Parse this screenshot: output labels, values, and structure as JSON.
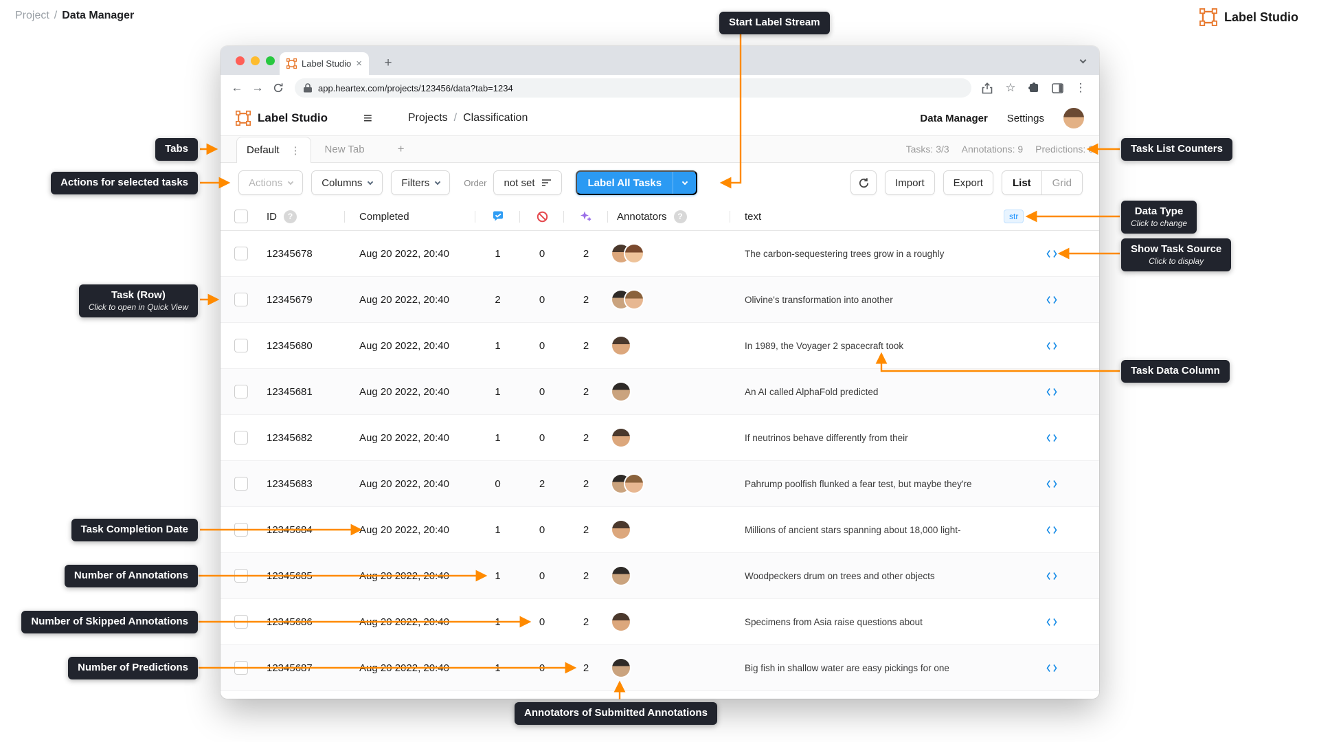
{
  "page": {
    "breadcrumb": {
      "section": "Project",
      "separator": "/",
      "current": "Data Manager"
    },
    "brand": "Label Studio"
  },
  "browser": {
    "tab_title": "Label Studio",
    "url": "app.heartex.com/projects/123456/data?tab=1234"
  },
  "header": {
    "brand": "Label Studio",
    "nav_projects": "Projects",
    "nav_separator": "/",
    "nav_current": "Classification",
    "menu_data_manager": "Data Manager",
    "menu_settings": "Settings"
  },
  "tabs": {
    "default_tab": "Default",
    "new_tab": "New Tab",
    "counters": {
      "tasks": "Tasks: 3/3",
      "annotations": "Annotations: 9",
      "predictions": "Predictions: 0"
    }
  },
  "toolbar": {
    "actions": "Actions",
    "columns": "Columns",
    "filters": "Filters",
    "order_label": "Order",
    "order_value": "not set",
    "label_all_tasks": "Label All Tasks",
    "import": "Import",
    "export": "Export",
    "list": "List",
    "grid": "Grid"
  },
  "table": {
    "headers": {
      "id": "ID",
      "completed": "Completed",
      "annotators": "Annotators",
      "text": "text",
      "data_type_badge": "str"
    },
    "rows": [
      {
        "id": "12345678",
        "completed": "Aug 20 2022, 20:40",
        "annotated": 1,
        "skipped": 0,
        "predictions": 2,
        "annotators": 2,
        "text": "The carbon-sequestering trees grow in a roughly"
      },
      {
        "id": "12345679",
        "completed": "Aug 20 2022, 20:40",
        "annotated": 2,
        "skipped": 0,
        "predictions": 2,
        "annotators": 2,
        "text": "Olivine's transformation into another"
      },
      {
        "id": "12345680",
        "completed": "Aug 20 2022, 20:40",
        "annotated": 1,
        "skipped": 0,
        "predictions": 2,
        "annotators": 1,
        "text": "In 1989, the Voyager 2 spacecraft took"
      },
      {
        "id": "12345681",
        "completed": "Aug 20 2022, 20:40",
        "annotated": 1,
        "skipped": 0,
        "predictions": 2,
        "annotators": 1,
        "text": "An AI called AlphaFold predicted"
      },
      {
        "id": "12345682",
        "completed": "Aug 20 2022, 20:40",
        "annotated": 1,
        "skipped": 0,
        "predictions": 2,
        "annotators": 1,
        "text": "If neutrinos behave differently from their"
      },
      {
        "id": "12345683",
        "completed": "Aug 20 2022, 20:40",
        "annotated": 0,
        "skipped": 2,
        "predictions": 2,
        "annotators": 2,
        "text": "Pahrump poolfish flunked a fear test, but maybe they're"
      },
      {
        "id": "12345684",
        "completed": "Aug 20 2022, 20:40",
        "annotated": 1,
        "skipped": 0,
        "predictions": 2,
        "annotators": 1,
        "text": "Millions of ancient stars spanning about 18,000 light-"
      },
      {
        "id": "12345685",
        "completed": "Aug 20 2022, 20:40",
        "annotated": 1,
        "skipped": 0,
        "predictions": 2,
        "annotators": 1,
        "text": "Woodpeckers drum on trees and other objects"
      },
      {
        "id": "12345686",
        "completed": "Aug 20 2022, 20:40",
        "annotated": 1,
        "skipped": 0,
        "predictions": 2,
        "annotators": 1,
        "text": "Specimens from Asia raise questions about"
      },
      {
        "id": "12345687",
        "completed": "Aug 20 2022, 20:40",
        "annotated": 1,
        "skipped": 0,
        "predictions": 2,
        "annotators": 1,
        "text": "Big fish in shallow water are easy pickings for one"
      }
    ]
  },
  "callouts": {
    "start_label_stream": "Start Label Stream",
    "tabs": "Tabs",
    "actions": "Actions for selected tasks",
    "task_list_counters": "Task List Counters",
    "data_type": {
      "title": "Data Type",
      "sub": "Click to change"
    },
    "show_task_source": {
      "title": "Show Task Source",
      "sub": "Click to display"
    },
    "task_row": {
      "title": "Task (Row)",
      "sub": "Click to open in Quick View"
    },
    "task_data_column": "Task Data Column",
    "task_completion_date": "Task Completion Date",
    "number_of_annotations": "Number of Annotations",
    "number_of_skipped": "Number of Skipped Annotations",
    "number_of_predictions": "Number of Predictions",
    "annotators_submitted": "Annotators of Submitted Annotations"
  },
  "icons": {
    "close": "×",
    "plus": "+",
    "kebab": "⋮",
    "hamburger": "≡",
    "star": "☆",
    "back": "←",
    "forward": "→",
    "help": "?"
  },
  "colors": {
    "accent_orange": "#FF8A00",
    "logo_orange": "#E8792E",
    "primary_blue": "#2B9AF3",
    "skipped_red": "#E5484D",
    "predictions_purple": "#9A6EE8",
    "callout_bg": "#21242D"
  }
}
